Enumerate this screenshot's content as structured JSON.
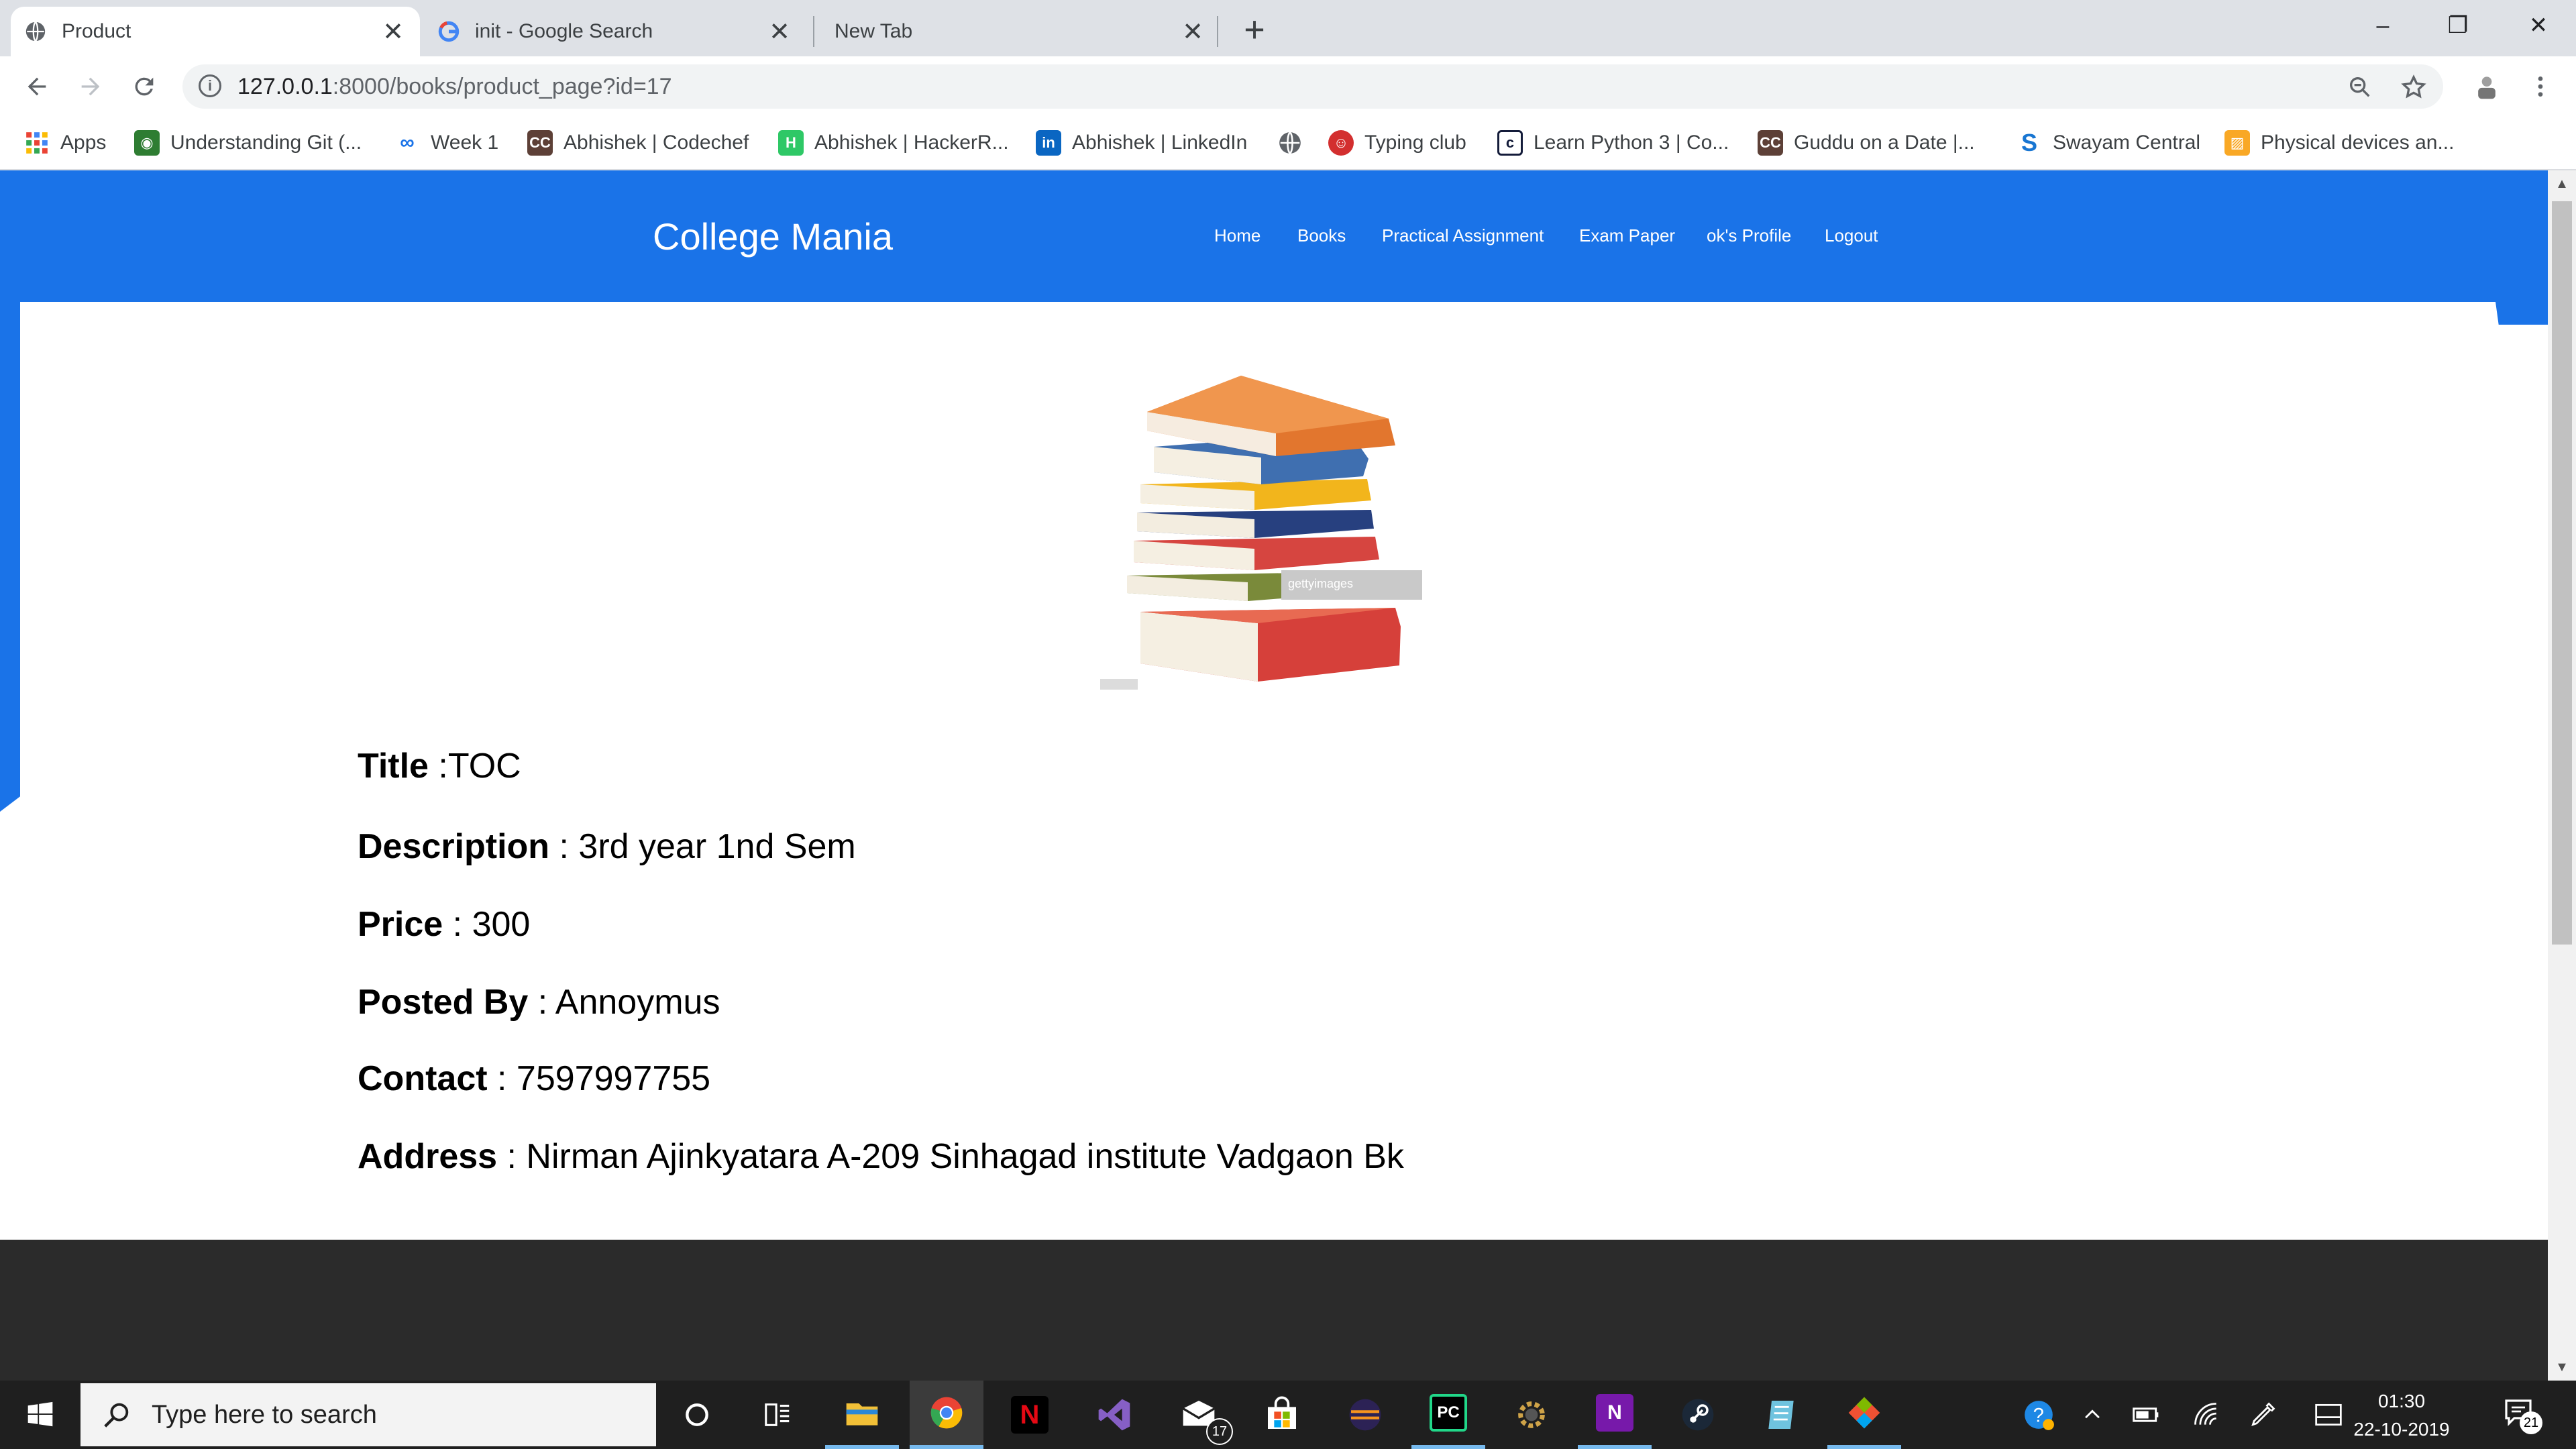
{
  "browser": {
    "tabs": [
      {
        "title": "Product",
        "active": true,
        "icon": "globe-icon"
      },
      {
        "title": "init - Google Search",
        "active": false,
        "icon": "google-icon"
      },
      {
        "title": "New Tab",
        "active": false,
        "icon": ""
      }
    ],
    "window_controls": {
      "minimize": "–",
      "restore": "❐",
      "close": "✕"
    },
    "address": {
      "host": "127.0.0.1",
      "path": ":8000/books/product_page?id=17"
    },
    "bookmarks": [
      {
        "label": "Apps",
        "icon": "apps-grid-icon",
        "color": "#ea4335"
      },
      {
        "label": "Understanding Git (...",
        "icon": "git-icon",
        "color": "#2e7d32"
      },
      {
        "label": "Week 1",
        "icon": "coursera-infinity-icon",
        "color": "#1a73e8"
      },
      {
        "label": "Abhishek | Codechef",
        "icon": "codechef-icon",
        "color": "#5d4037"
      },
      {
        "label": "Abhishek | HackerR...",
        "icon": "hackerrank-icon",
        "color": "#2ec866"
      },
      {
        "label": "Abhishek | LinkedIn",
        "icon": "linkedin-icon",
        "color": "#0a66c2"
      },
      {
        "label": "",
        "icon": "globe-icon",
        "color": "#5f6368"
      },
      {
        "label": "Typing club",
        "icon": "typingclub-icon",
        "color": "#d32f2f"
      },
      {
        "label": "Learn Python 3 | Co...",
        "icon": "codecademy-icon",
        "color": "#141c3a"
      },
      {
        "label": "Guddu on a Date |...",
        "icon": "codechef-icon",
        "color": "#5d4037"
      },
      {
        "label": "Swayam Central",
        "icon": "swayam-icon",
        "color": "#1976d2"
      },
      {
        "label": "Physical devices an...",
        "icon": "image-icon",
        "color": "#f9a825"
      }
    ]
  },
  "site": {
    "brand": "College Mania",
    "nav": [
      "Home",
      "Books",
      "Practical Assignment",
      "Exam Paper",
      "ok's Profile",
      "Logout"
    ],
    "image_watermark": "gettyimages",
    "fields": [
      {
        "label": "Title",
        "sep": " :",
        "value": "TOC"
      },
      {
        "label": "Description",
        "sep": " : ",
        "value": "3rd year 1nd Sem"
      },
      {
        "label": "Price",
        "sep": " : ",
        "value": "300"
      },
      {
        "label": "Posted By",
        "sep": " : ",
        "value": "Annoymus"
      },
      {
        "label": "Contact",
        "sep": " : ",
        "value": "7597997755"
      },
      {
        "label": "Address",
        "sep": " : ",
        "value": "Nirman Ajinkyatara A-209 Sinhagad institute Vadgaon Bk"
      }
    ],
    "colors": {
      "nav_blue": "#1a73e8",
      "footer": "#2b2b2b"
    }
  },
  "taskbar": {
    "search_placeholder": "Type here to search",
    "apps": [
      {
        "name": "cortana",
        "label": "",
        "color": ""
      },
      {
        "name": "task-view",
        "label": "",
        "color": ""
      },
      {
        "name": "file-explorer",
        "label": "",
        "color": "#f2c037"
      },
      {
        "name": "chrome",
        "label": "",
        "color": "#4285f4"
      },
      {
        "name": "netflix",
        "label": "N",
        "color": "#e50914"
      },
      {
        "name": "visual-studio",
        "label": "",
        "color": "#865fc5"
      },
      {
        "name": "mail",
        "label": "",
        "color": "#ffffff",
        "badge": "17"
      },
      {
        "name": "store",
        "label": "",
        "color": "#ffffff"
      },
      {
        "name": "eclipse",
        "label": "",
        "color": "#2c2255"
      },
      {
        "name": "pycharm",
        "label": "PC",
        "color": "#21d789"
      },
      {
        "name": "settings-gear",
        "label": "",
        "color": "#aaaaaa"
      },
      {
        "name": "onenote",
        "label": "N",
        "color": "#7719aa"
      },
      {
        "name": "steam",
        "label": "",
        "color": "#1b2838"
      },
      {
        "name": "notes",
        "label": "",
        "color": "#6fc3df"
      },
      {
        "name": "git-gui",
        "label": "",
        "color": "#f05133"
      }
    ],
    "time": "01:30",
    "date": "22-10-2019",
    "notifications": "21"
  }
}
